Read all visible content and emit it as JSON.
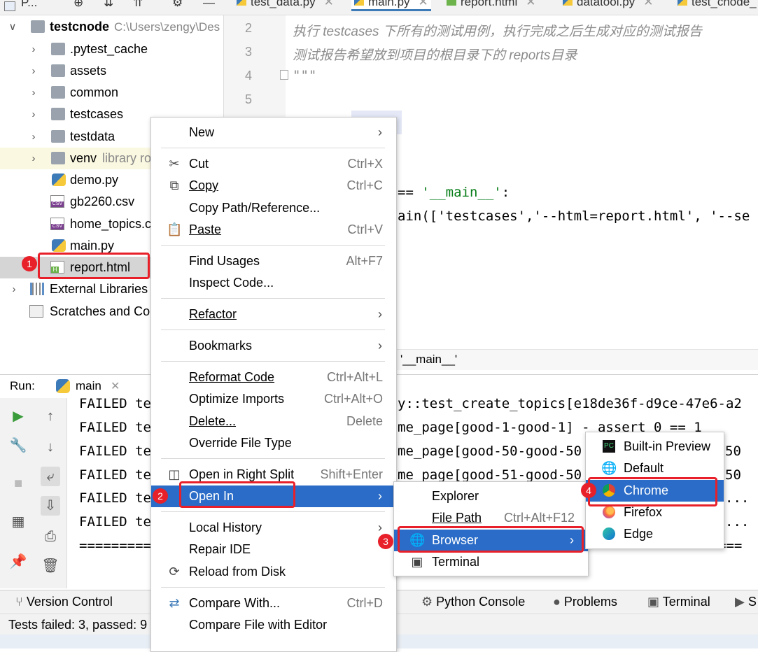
{
  "project": {
    "toolbar_title": "P...",
    "root_name": "testcnode",
    "root_path": "C:\\Users\\zengy\\Des",
    "items": [
      {
        "label": ".pytest_cache"
      },
      {
        "label": "assets"
      },
      {
        "label": "common"
      },
      {
        "label": "testcases"
      },
      {
        "label": "testdata"
      },
      {
        "label": "venv",
        "hint": "library ro"
      },
      {
        "label": "demo.py"
      },
      {
        "label": "gb2260.csv"
      },
      {
        "label": "home_topics.c"
      },
      {
        "label": "main.py"
      },
      {
        "label": "report.html"
      },
      {
        "label": "External Libraries"
      },
      {
        "label": "Scratches and Cor"
      }
    ]
  },
  "editor": {
    "tabs": [
      "test_data.py",
      "main.py",
      "report.html",
      "datatool.py",
      "test_cnode_"
    ],
    "line_numbers": [
      "2",
      "3",
      "4",
      "5"
    ],
    "comment1": "执行 testcases 下所有的测试用例，执行完成之后生成对应的测试报告",
    "comment2": "测试报告希望放到项目的根目录下的 reports目录",
    "docquote": "\"\"\"",
    "code_frag1": "== '__main__':",
    "code_frag2": "ain(['testcases','--html=report.html', '--se",
    "breadcrumb": "'__main__'"
  },
  "run": {
    "label": "Run:",
    "config": "main",
    "lines": [
      "FAILED te",
      "FAILED te",
      "FAILED te",
      "FAILED te",
      "FAILED te",
      "FAILED te",
      "========="
    ],
    "right_lines": [
      "y::test_create_topics[e18de36f-d9ce-47e6-a2",
      "me_page[good-1-good-1] - assert 0 == 1",
      "me_page[good-50-good-50",
      "me_page[good-51-good-50"
    ],
    "right_tail": [
      "50",
      "50",
      "...",
      "...",
      "==="
    ]
  },
  "bottom_tabs": [
    "Version Control",
    "Python Console",
    "Problems",
    "Terminal",
    "S"
  ],
  "status": "Tests failed: 3, passed: 9",
  "context_menu": [
    {
      "label": "New",
      "submenu": true
    },
    {
      "label": "Cut",
      "shortcut": "Ctrl+X",
      "icon": "scissors-icon"
    },
    {
      "label": "Copy",
      "shortcut": "Ctrl+C",
      "icon": "copy-icon"
    },
    {
      "label": "Copy Path/Reference..."
    },
    {
      "label": "Paste",
      "shortcut": "Ctrl+V",
      "icon": "paste-icon"
    },
    {
      "label": "Find Usages",
      "shortcut": "Alt+F7"
    },
    {
      "label": "Inspect Code..."
    },
    {
      "label": "Refactor",
      "submenu": true
    },
    {
      "label": "Bookmarks",
      "submenu": true
    },
    {
      "label": "Reformat Code",
      "shortcut": "Ctrl+Alt+L"
    },
    {
      "label": "Optimize Imports",
      "shortcut": "Ctrl+Alt+O"
    },
    {
      "label": "Delete...",
      "shortcut": "Delete"
    },
    {
      "label": "Override File Type"
    },
    {
      "label": "Open in Right Split",
      "shortcut": "Shift+Enter",
      "icon": "split-icon"
    },
    {
      "label": "Open In",
      "submenu": true,
      "selected": true
    },
    {
      "label": "Local History",
      "submenu": true
    },
    {
      "label": "Repair IDE"
    },
    {
      "label": "Reload from Disk",
      "icon": "reload-icon"
    },
    {
      "label": "Compare With...",
      "shortcut": "Ctrl+D",
      "icon": "compare-icon"
    },
    {
      "label": "Compare File with Editor"
    }
  ],
  "open_in_menu": [
    {
      "label": "Explorer"
    },
    {
      "label": "File Path",
      "shortcut": "Ctrl+Alt+F12"
    },
    {
      "label": "Browser",
      "submenu": true,
      "selected": true,
      "icon": "globe-icon"
    },
    {
      "label": "Terminal",
      "icon": "terminal-icon"
    }
  ],
  "browser_menu": [
    {
      "label": "Built-in Preview",
      "icon": "pycharm-icon"
    },
    {
      "label": "Default",
      "icon": "globe-icon"
    },
    {
      "label": "Chrome",
      "icon": "chrome-icon",
      "selected": true
    },
    {
      "label": "Firefox",
      "icon": "firefox-icon"
    },
    {
      "label": "Edge",
      "icon": "edge-icon"
    }
  ],
  "badges": [
    "1",
    "2",
    "3",
    "4"
  ],
  "colors": {
    "selection": "#2a6cc7",
    "annotation": "#e8202a",
    "string": "#067d17",
    "comment": "#8c8c8c"
  }
}
